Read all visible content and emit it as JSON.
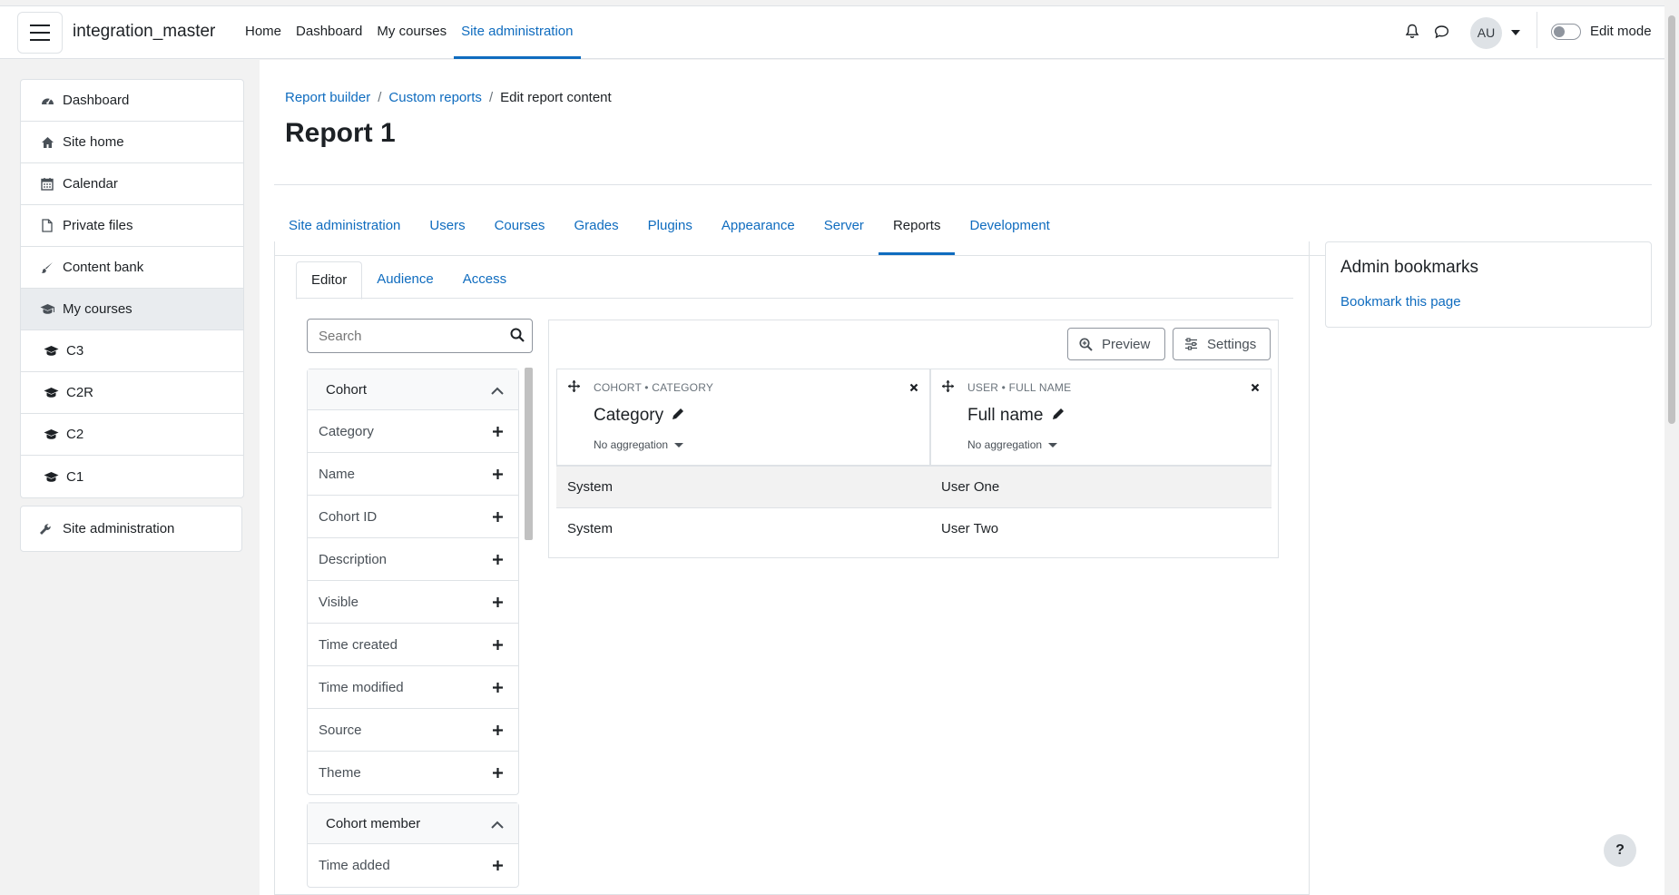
{
  "navbar": {
    "site_name": "integration_master",
    "items": [
      "Home",
      "Dashboard",
      "My courses",
      "Site administration"
    ],
    "active_item": "Site administration",
    "avatar_initials": "AU",
    "edit_mode_label": "Edit mode"
  },
  "drawer": {
    "items": [
      {
        "label": "Dashboard",
        "icon": "dashboard-icon"
      },
      {
        "label": "Site home",
        "icon": "home-icon"
      },
      {
        "label": "Calendar",
        "icon": "calendar-icon"
      },
      {
        "label": "Private files",
        "icon": "file-icon"
      },
      {
        "label": "Content bank",
        "icon": "paintbrush-icon"
      },
      {
        "label": "My courses",
        "icon": "graduation-cap-icon"
      },
      {
        "label": "C3",
        "icon": "graduation-cap-icon"
      },
      {
        "label": "C2R",
        "icon": "graduation-cap-icon"
      },
      {
        "label": "C2",
        "icon": "graduation-cap-icon"
      },
      {
        "label": "C1",
        "icon": "graduation-cap-icon"
      }
    ],
    "admin": {
      "label": "Site administration",
      "icon": "wrench-icon"
    }
  },
  "breadcrumb": {
    "items": [
      "Report builder",
      "Custom reports"
    ],
    "current": "Edit report content"
  },
  "page_title": "Report 1",
  "secondary_nav": {
    "items": [
      "Site administration",
      "Users",
      "Courses",
      "Grades",
      "Plugins",
      "Appearance",
      "Server",
      "Reports",
      "Development"
    ],
    "active": "Reports"
  },
  "editor_tabs": {
    "items": [
      "Editor",
      "Audience",
      "Access"
    ],
    "active": "Editor"
  },
  "search": {
    "placeholder": "Search",
    "value": ""
  },
  "sidebar_cards": [
    {
      "title": "Cohort",
      "items": [
        "Category",
        "Name",
        "Cohort ID",
        "Description",
        "Visible",
        "Time created",
        "Time modified",
        "Source",
        "Theme"
      ]
    },
    {
      "title": "Cohort member",
      "items": [
        "Time added"
      ]
    }
  ],
  "report": {
    "preview_label": "Preview",
    "settings_label": "Settings",
    "columns": [
      {
        "caption": "COHORT • CATEGORY",
        "name": "Category",
        "aggregation": "No aggregation"
      },
      {
        "caption": "USER • FULL NAME",
        "name": "Full name",
        "aggregation": "No aggregation"
      }
    ],
    "rows": [
      [
        "System",
        "User One"
      ],
      [
        "System",
        "User Two"
      ]
    ]
  },
  "bookmarks": {
    "title": "Admin bookmarks",
    "link": "Bookmark this page"
  },
  "help_label": "?",
  "colors": {
    "accent": "#0f6cbf",
    "border": "#dee2e6",
    "drawer_bg": "#f2f2f2"
  }
}
